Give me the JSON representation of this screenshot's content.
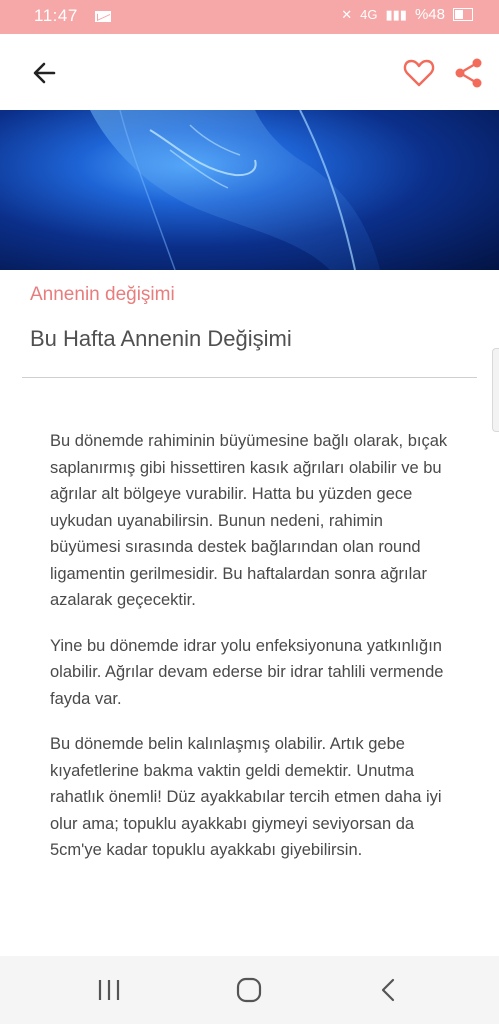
{
  "status_bar": {
    "time": "11:47",
    "battery": "%48",
    "signal": "4G"
  },
  "toolbar": {
    "back_icon": "arrow-left-icon",
    "favorite_icon": "heart-icon",
    "share_icon": "share-icon",
    "accent_color": "#f26b5b"
  },
  "article": {
    "category": "Annenin değişimi",
    "title": "Bu Hafta Annenin Değişimi",
    "paragraphs": [
      "Bu dönemde rahiminin büyümesine bağlı olarak, bıçak saplanırmış gibi hissettiren kasık ağrıları olabilir ve bu ağrılar alt bölgeye vurabilir. Hatta bu yüzden gece uykudan uyanabilirsin. Bunun nedeni, rahimin büyümesi sırasında destek bağlarından olan round ligamentin gerilmesidir. Bu haftalardan sonra ağrılar azalarak geçecektir.",
      "Yine bu dönemde idrar yolu enfeksiyonuna yatkınlığın olabilir. Ağrılar devam ederse bir idrar tahlili vermende fayda var.",
      "Bu dönemde belin kalınlaşmış olabilir. Artık gebe kıyafetlerine bakma vaktin geldi demektir. Unutma rahatlık önemli! Düz ayakkabılar tercih etmen daha iyi olur ama; topuklu ayakkabı giymeyi seviyorsan da 5cm'ye kadar topuklu ayakkabı giyebilirsin."
    ]
  },
  "nav_bar": {
    "recents_icon": "recent-apps-icon",
    "home_icon": "home-icon",
    "back_icon": "back-chevron-icon"
  }
}
